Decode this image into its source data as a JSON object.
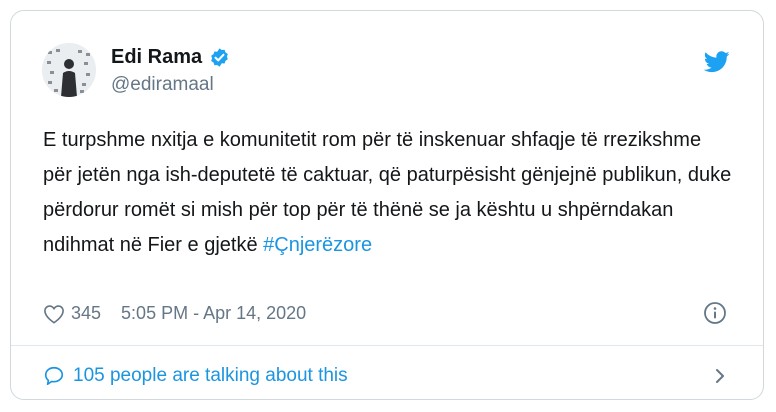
{
  "author": {
    "name": "Edi Rama",
    "handle": "@ediramaal"
  },
  "tweet": {
    "text": "E turpshme nxitja e komunitetit rom për të inskenuar shfaqje të rrezikshme për jetën nga ish-deputetë të caktuar, që paturpësisht gënjejnë publikun, duke përdorur romët si mish për top për të thënë se ja kështu u shpërndakan ndihmat në Fier e gjetkë",
    "hashtag": "#Çnjerëzore"
  },
  "meta": {
    "likes": "345",
    "timestamp": "5:05 PM - Apr 14, 2020"
  },
  "footer": {
    "talking": "105 people are talking about this"
  },
  "colors": {
    "accent": "#1b95e0",
    "twitter_blue": "#1da1f2",
    "text": "#14171a",
    "muted": "#657786",
    "border": "#cfd9de"
  },
  "icons": [
    "verified-badge-icon",
    "twitter-bird-icon",
    "heart-icon",
    "info-icon",
    "speech-bubble-icon",
    "chevron-right-icon"
  ]
}
